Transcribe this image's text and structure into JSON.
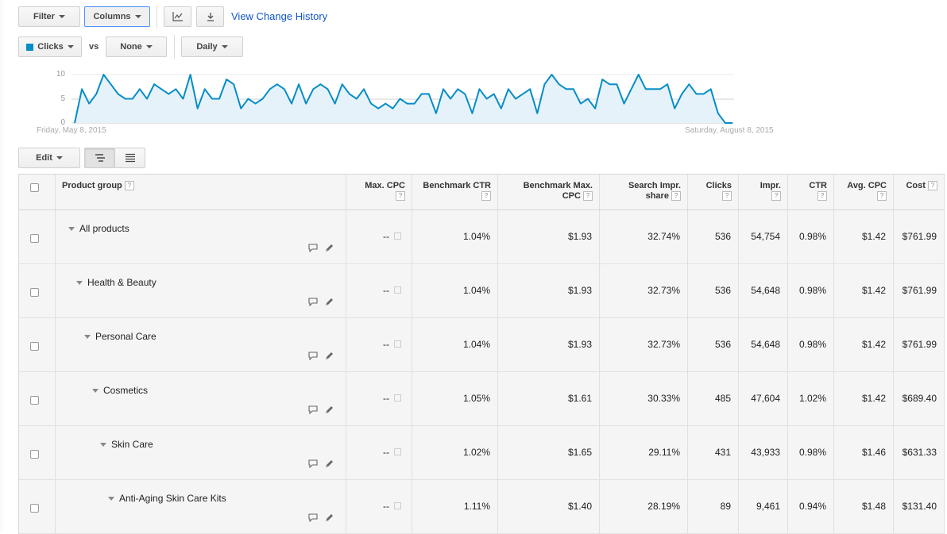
{
  "toolbar": {
    "filter_label": "Filter",
    "columns_label": "Columns",
    "view_history_link": "View Change History"
  },
  "chart_controls": {
    "metric_label": "Clicks",
    "vs_label": "vs",
    "compare_label": "None",
    "interval_label": "Daily"
  },
  "colors": {
    "accent": "#058dc7",
    "fill": "#e6f2f9",
    "link": "#1155cc"
  },
  "chart_data": {
    "type": "area",
    "title": "",
    "xlabel": "",
    "ylabel": "",
    "ylim": [
      0,
      10
    ],
    "yticks": [
      "10",
      "5",
      "0"
    ],
    "x_start_label": "Friday, May 8, 2015",
    "x_end_label": "Saturday, August 8, 2015",
    "grid": true,
    "series": [
      {
        "values": [
          0,
          7,
          4,
          6,
          10,
          8,
          6,
          5,
          5,
          7,
          5,
          8,
          7,
          6,
          7,
          5,
          10,
          3,
          7,
          5,
          5,
          9,
          8,
          3,
          5,
          4,
          5,
          7,
          8,
          7,
          4,
          8,
          4,
          7,
          8,
          7,
          4,
          8,
          6,
          5,
          7,
          4,
          3,
          4,
          3,
          5,
          4,
          4,
          6,
          6,
          2,
          7,
          5,
          7,
          6,
          2,
          7,
          5,
          6,
          3,
          7,
          5,
          6,
          7,
          2,
          8,
          10,
          8,
          7,
          7,
          4,
          5,
          3,
          9,
          8,
          8,
          4,
          7,
          10,
          7,
          7,
          7,
          8,
          3,
          6,
          8,
          6,
          6,
          7,
          2,
          0,
          0
        ]
      }
    ]
  },
  "edit_label": "Edit",
  "table": {
    "headers": {
      "product_group": "Product group",
      "max_cpc": "Max. CPC",
      "bench_ctr": "Benchmark CTR",
      "bench_max_cpc_1": "Benchmark Max.",
      "bench_max_cpc_2": "CPC",
      "search_impr_1": "Search Impr.",
      "search_impr_2": "share",
      "clicks": "Clicks",
      "impr": "Impr.",
      "ctr": "CTR",
      "avg_cpc": "Avg. CPC",
      "cost": "Cost",
      "help": "?"
    },
    "rows": [
      {
        "name": "All products",
        "max_cpc": "--",
        "bench_ctr": "1.04%",
        "bench_max_cpc": "$1.93",
        "search_impr": "32.74%",
        "clicks": "536",
        "impr": "54,754",
        "ctr": "0.98%",
        "avg_cpc": "$1.42",
        "cost": "$761.99"
      },
      {
        "name": "Health & Beauty",
        "max_cpc": "--",
        "bench_ctr": "1.04%",
        "bench_max_cpc": "$1.93",
        "search_impr": "32.73%",
        "clicks": "536",
        "impr": "54,648",
        "ctr": "0.98%",
        "avg_cpc": "$1.42",
        "cost": "$761.99"
      },
      {
        "name": "Personal Care",
        "max_cpc": "--",
        "bench_ctr": "1.04%",
        "bench_max_cpc": "$1.93",
        "search_impr": "32.73%",
        "clicks": "536",
        "impr": "54,648",
        "ctr": "0.98%",
        "avg_cpc": "$1.42",
        "cost": "$761.99"
      },
      {
        "name": "Cosmetics",
        "max_cpc": "--",
        "bench_ctr": "1.05%",
        "bench_max_cpc": "$1.61",
        "search_impr": "30.33%",
        "clicks": "485",
        "impr": "47,604",
        "ctr": "1.02%",
        "avg_cpc": "$1.42",
        "cost": "$689.40"
      },
      {
        "name": "Skin Care",
        "max_cpc": "--",
        "bench_ctr": "1.02%",
        "bench_max_cpc": "$1.65",
        "search_impr": "29.11%",
        "clicks": "431",
        "impr": "43,933",
        "ctr": "0.98%",
        "avg_cpc": "$1.46",
        "cost": "$631.33"
      },
      {
        "name": "Anti-Aging Skin Care Kits",
        "max_cpc": "--",
        "bench_ctr": "1.11%",
        "bench_max_cpc": "$1.40",
        "search_impr": "28.19%",
        "clicks": "89",
        "impr": "9,461",
        "ctr": "0.94%",
        "avg_cpc": "$1.48",
        "cost": "$131.40"
      }
    ]
  }
}
